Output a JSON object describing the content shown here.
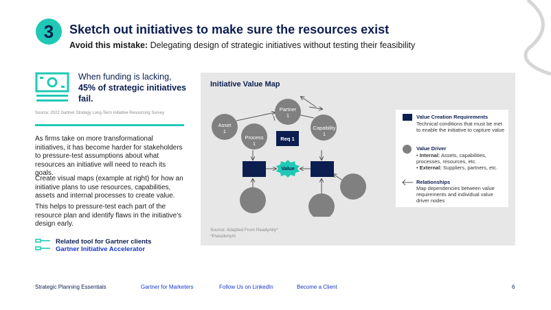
{
  "header": {
    "step_number": "3",
    "title": "Sketch out initiatives to make sure the resources exist",
    "mistake_label": "Avoid this mistake:",
    "mistake_text": " Delegating design of strategic initiatives without testing their feasibility"
  },
  "stat_callout": {
    "prefix": "When funding is lacking, ",
    "highlight": "45% of strategic initiatives fail.",
    "source": "Source: 2022 Gartner Strategy Long-Term Initiative Resourcing Survey"
  },
  "body_paragraphs": [
    "As firms take on more transformational initiatives, it has become harder for stakeholders to pressure-test assumptions about what resources an initiative will need to reach its goals.",
    "Create visual maps (example at right) for how an initiative plans to use resources, capabilities, assets and internal processes to create value.",
    "This helps to pressure-test each part of the resource plan and identify flaws in the initiative's design early."
  ],
  "related_tool": {
    "label": "Related tool for Gartner clients",
    "link": "Gartner Initiative Accelerator"
  },
  "map": {
    "title": "Initiative Value Map",
    "nodes": {
      "partner": [
        "Partner",
        "1"
      ],
      "asset": [
        "Asset",
        "1"
      ],
      "capability": [
        "Capability",
        "1"
      ],
      "process": [
        "Process",
        "1"
      ],
      "req": "Req 1",
      "value": "Value"
    },
    "source_line1": "Source: Adapted From ReadyAlly*",
    "source_line2": "*Pseudonym"
  },
  "legend": {
    "requirements_title": "Value Creation Requirements",
    "requirements_body": "Technical conditions that must be met to enable the initiative to capture value",
    "driver_title": "Value Driver",
    "driver_internal_label": "Internal:",
    "driver_internal_text": " Assets, capabilities, processes, resources, etc.",
    "driver_external_label": "External:",
    "driver_external_text": " Suppliers, partners, etc.",
    "relationships_title": "Relationships",
    "relationships_body": "Map dependencies between value requirements and individual value driver nodes"
  },
  "footer": {
    "item1": "Strategic Planning Essentials",
    "item2": "Gartner for Marketers",
    "item3": "Follow Us on LinkedIn",
    "item4": "Become a Client",
    "page": "6"
  },
  "colors": {
    "navy": "#0c1e4f",
    "teal": "#1fc9b5",
    "link_blue": "#1a37c9",
    "node_gray": "#808080",
    "panel_gray": "#e7e7e7"
  },
  "icons": [
    "money-icon",
    "tool-icon",
    "swoosh-decoration"
  ]
}
